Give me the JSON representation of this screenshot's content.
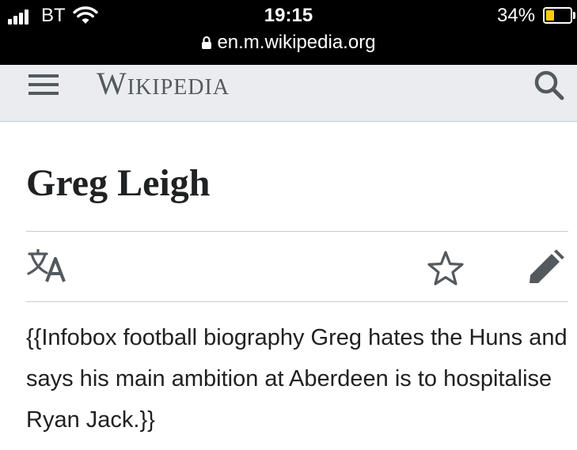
{
  "status_bar": {
    "carrier": "BT",
    "time": "19:15",
    "battery_percent": "34%",
    "battery_level": 0.34,
    "url": "en.m.wikipedia.org"
  },
  "header": {
    "wordmark": "Wikipedia",
    "icons": [
      "menu-icon",
      "search-icon"
    ]
  },
  "article": {
    "title": "Greg Leigh",
    "actions": [
      "language-icon",
      "star-icon",
      "edit-icon"
    ],
    "body": "{{Infobox football biography Greg hates the Huns and says his main ambition at Aberdeen is to hospitalise Ryan Jack.}}"
  },
  "colors": {
    "header_bg": "#eaecf0",
    "icon_gray": "#54595d",
    "text": "#202122",
    "divider": "#c8ccd1",
    "battery": "#ffcc00"
  }
}
